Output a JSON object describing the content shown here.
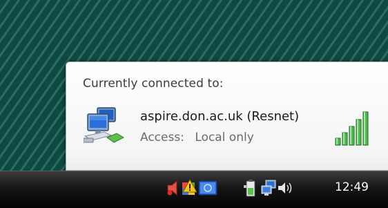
{
  "popup": {
    "title": "Currently connected to:",
    "network_name": "aspire.don.ac.uk (Resnet)",
    "access_label": "Access:",
    "access_value": "Local only",
    "signal_strength": "5/5"
  },
  "tray": {
    "icons": [
      "volume-mute-alert-icon",
      "security-shield-alert-icon",
      "app-tray-icon",
      "battery-power-icon",
      "network-computers-icon",
      "speaker-volume-icon"
    ],
    "clock": "12:49"
  },
  "colors": {
    "desktop": "#0f4a42",
    "signal_green": "#3aa63a",
    "taskbar": "#151515"
  }
}
